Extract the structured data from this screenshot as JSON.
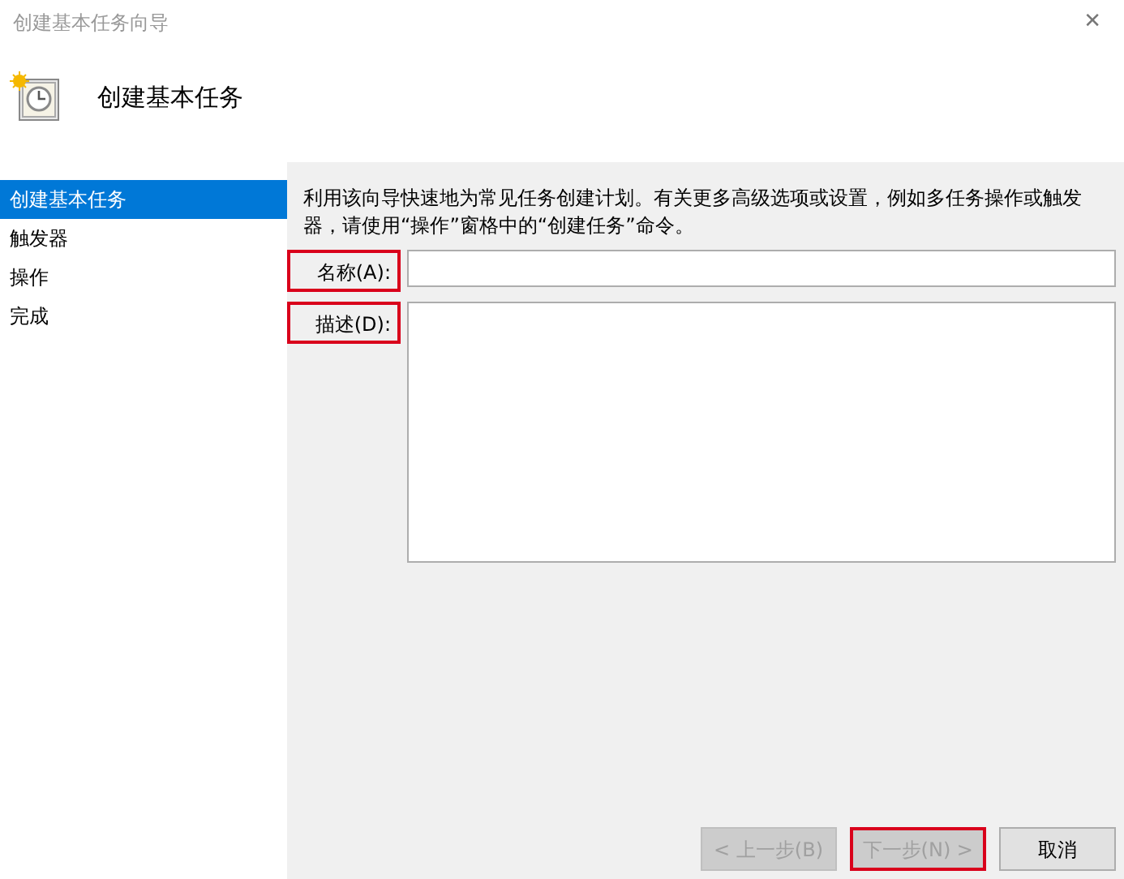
{
  "window": {
    "title": "创建基本任务向导",
    "close": "✕"
  },
  "header": {
    "title": "创建基本任务"
  },
  "sidebar": {
    "items": [
      {
        "label": "创建基本任务",
        "selected": true
      },
      {
        "label": "触发器",
        "selected": false
      },
      {
        "label": "操作",
        "selected": false
      },
      {
        "label": "完成",
        "selected": false
      }
    ]
  },
  "description": "利用该向导快速地为常见任务创建计划。有关更多高级选项或设置，例如多任务操作或触发器，请使用“操作”窗格中的“创建任务”命令。",
  "fields": [
    {
      "label": "名称(A):",
      "kind": "input",
      "highlighted": true
    },
    {
      "label": "描述(D):",
      "kind": "textarea",
      "highlighted": true
    }
  ],
  "buttons": [
    {
      "label": "< 上一步(B)",
      "disabled": true,
      "highlighted": false
    },
    {
      "label": "下一步(N) >",
      "disabled": true,
      "highlighted": true
    },
    {
      "label": "取消",
      "disabled": false,
      "highlighted": false
    }
  ]
}
